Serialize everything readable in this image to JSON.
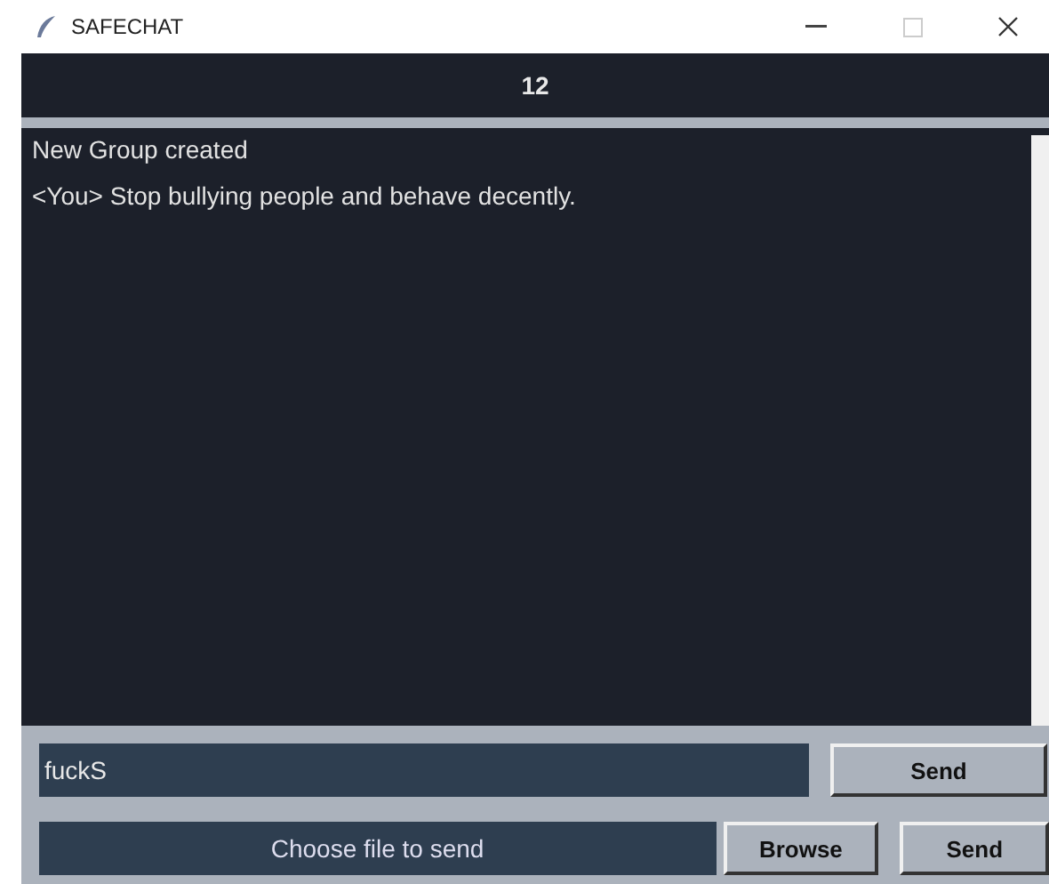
{
  "window": {
    "title": "SAFECHAT"
  },
  "header": {
    "title": "12"
  },
  "messages": [
    "New Group created",
    "<You> Stop bullying people and behave decently."
  ],
  "message_input": {
    "value": "fuckS"
  },
  "send_button": "Send",
  "file_row": {
    "label": "Choose file to send",
    "browse_button": "Browse",
    "send_button": "Send"
  }
}
